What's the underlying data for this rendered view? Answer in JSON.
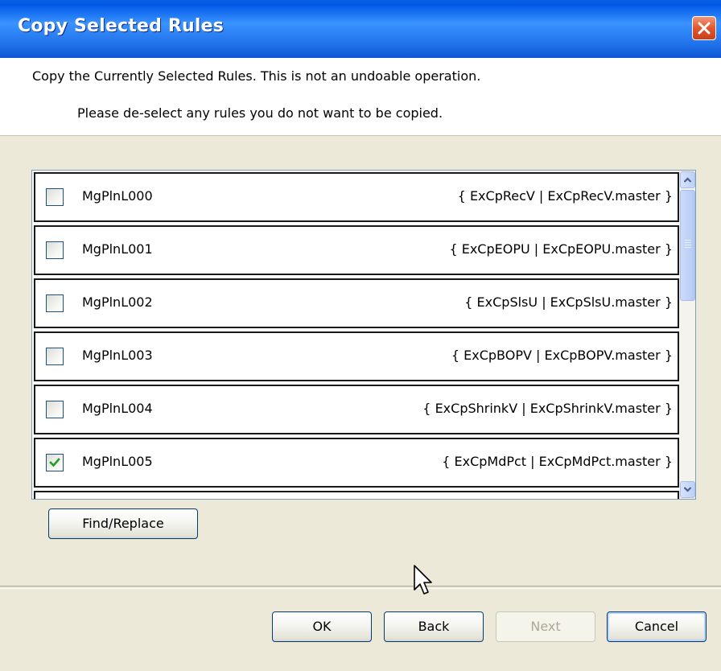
{
  "dialog": {
    "title": "Copy Selected Rules",
    "description": "Copy the Currently Selected Rules. This is not an undoable operation.",
    "instruction": "Please de-select any rules you do not want to be copied."
  },
  "rules": [
    {
      "name": "MgPlnL000",
      "target": "{ ExCpRecV | ExCpRecV.master }",
      "checked": false
    },
    {
      "name": "MgPlnL001",
      "target": "{ ExCpEOPU | ExCpEOPU.master }",
      "checked": false
    },
    {
      "name": "MgPlnL002",
      "target": "{ ExCpSlsU | ExCpSlsU.master }",
      "checked": false
    },
    {
      "name": "MgPlnL003",
      "target": "{ ExCpBOPV | ExCpBOPV.master }",
      "checked": false
    },
    {
      "name": "MgPlnL004",
      "target": "{ ExCpShrinkV | ExCpShrinkV.master }",
      "checked": false
    },
    {
      "name": "MgPlnL005",
      "target": "{ ExCpMdPct | ExCpMdPct.master }",
      "checked": true
    }
  ],
  "buttons": {
    "find_replace": "Find/Replace",
    "ok": "OK",
    "back": "Back",
    "next": "Next",
    "cancel": "Cancel"
  },
  "colors": {
    "titlebar": "#0058e6",
    "window_background": "#ece9d8",
    "checkmark": "#21a121"
  },
  "icons": {
    "close": "close-x-icon",
    "scroll_up": "chevron-up-icon",
    "scroll_down": "chevron-down-icon",
    "cursor": "mouse-pointer-icon"
  }
}
